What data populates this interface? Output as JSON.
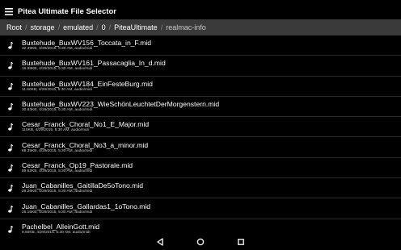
{
  "app": {
    "title": "Pitea Ultimate File Selector"
  },
  "breadcrumb": [
    "Root",
    "storage",
    "emulated",
    "0",
    "PiteaUltimate",
    "realmac-info"
  ],
  "files": [
    {
      "name": "Buxtehude_BuxWV156_Toccata_in_F.mid",
      "meta": "32.39KB, 4/29/2015, 5:30 AM, audio/midi"
    },
    {
      "name": "Buxtehude_BuxWV161_Passacaglia_In_d.mid",
      "meta": "16.98KB, 4/29/2015, 5:30 AM, audio/midi"
    },
    {
      "name": "Buxtehude_BuxWV184_EinFesteBurg.mid",
      "meta": "11.60KB, 4/29/2015, 5:30 AM, audio/midi"
    },
    {
      "name": "Buxtehude_BuxWV223_WieSchönLeuchtetDerMorgenstern.mid",
      "meta": "30.83KB, 4/29/2015, 5:30 AM, audio/midi"
    },
    {
      "name": "Cesar_Franck_Choral_No1_E_Major.mid",
      "meta": "115KB, 4/29/2015, 5:30 AM, audio/midi"
    },
    {
      "name": "Cesar_Franck_Choral_No3_a_minor.mid",
      "meta": "68.35KB, 4/29/2015, 5:30 AM, audio/midi"
    },
    {
      "name": "Cesar_Franck_Op19_Pastorale.mid",
      "meta": "89.62KB, 4/29/2015, 5:30 AM, audio/midi"
    },
    {
      "name": "Juan_Cabanilles_GaitillaDe5oTono.mid",
      "meta": "28.26KB, 4/29/2015, 5:30 AM, audio/midi"
    },
    {
      "name": "Juan_Cabanilles_Gallardas1_1oTono.mid",
      "meta": "25.15KB, 4/29/2015, 5:30 AM, audio/midi"
    },
    {
      "name": "Pachelbel_AlleinGott.mid",
      "meta": "9.50KB, 4/29/2015, 5:30 AM, audio/midi"
    }
  ],
  "icons": {
    "menu": "menu-icon",
    "file": "music-note-icon",
    "back": "back-triangle-icon",
    "home": "home-circle-icon",
    "recents": "recents-square-icon"
  },
  "colors": {
    "background": "#000000",
    "breadcrumb_bar": "#3a3a3a",
    "text": "#ffffff",
    "meta_text": "#cfcfcf"
  }
}
